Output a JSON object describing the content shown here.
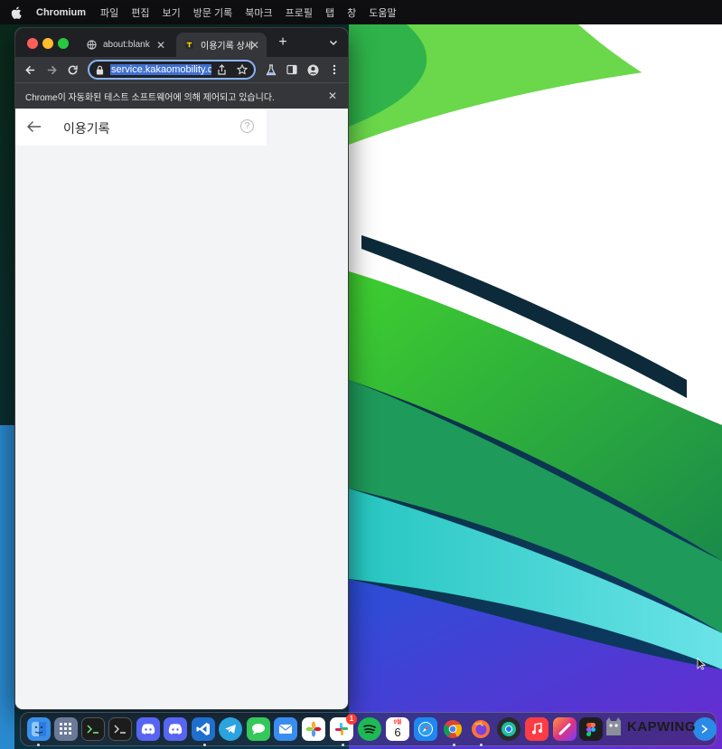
{
  "menubar": {
    "app_name": "Chromium",
    "items": [
      "파일",
      "편집",
      "보기",
      "방문 기록",
      "북마크",
      "프로필",
      "탭",
      "창",
      "도움말"
    ]
  },
  "browser": {
    "tabs": [
      {
        "label": "about:blank",
        "active": false
      },
      {
        "label": "이용기록 상세",
        "active": true
      }
    ],
    "url": "service.kakaomobility.c",
    "infobar_text": "Chrome이 자동화된 테스트 소프트웨어에 의해 제어되고 있습니다.",
    "page": {
      "title": "이용기록",
      "help_label": "?"
    }
  },
  "dock": {
    "calendar_month": "9월",
    "calendar_day": "6",
    "slack_badge": "1"
  },
  "watermark": {
    "text": "KAPWING"
  },
  "colors": {
    "omnibox_focus": "#8ab4f8",
    "url_selection": "#3f6fd0",
    "page_background": "#f3f4f6"
  }
}
